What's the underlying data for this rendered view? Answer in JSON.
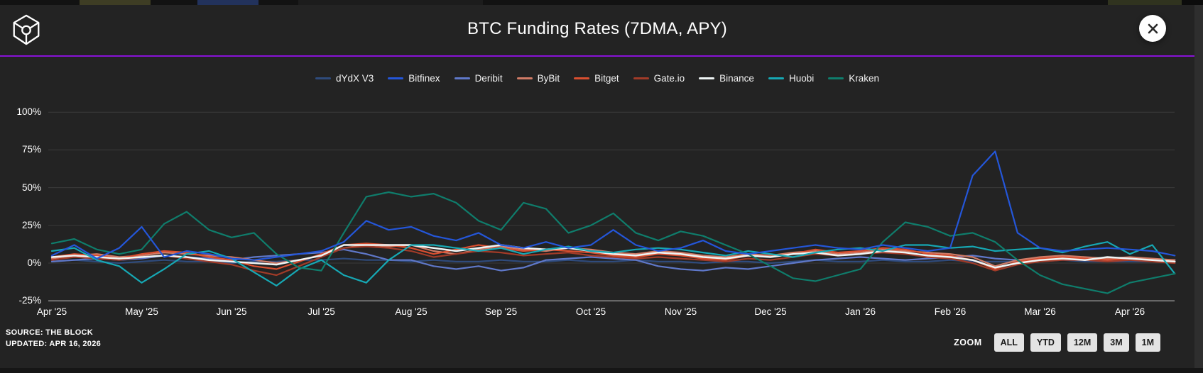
{
  "header": {
    "title": "BTC Funding Rates (7DMA, APY)"
  },
  "footer": {
    "source": "SOURCE: THE BLOCK",
    "updated": "UPDATED: APR 16, 2026"
  },
  "zoom_controls": {
    "label": "ZOOM",
    "buttons": [
      "ALL",
      "YTD",
      "12M",
      "3M",
      "1M"
    ]
  },
  "colors": {
    "background": "#232323",
    "header_divider": "#8812d6",
    "gridline": "#3b3b3b",
    "axis_line": "#8f8f8f",
    "text": "#ffffff",
    "close_button_bg": "#ffffff",
    "close_button_x": "#2a2a2a",
    "zoom_button_bg": "#e4e4e4"
  },
  "chart_data": {
    "type": "line",
    "title": "BTC Funding Rates (7DMA, APY)",
    "unit": "%",
    "ylim": [
      -25,
      100
    ],
    "grid": true,
    "legend_position": "top-center",
    "y_ticks": [
      100,
      75,
      50,
      25,
      0,
      -25
    ],
    "x_tick_labels": [
      "Apr '25",
      "May '25",
      "Jun '25",
      "Jul '25",
      "Aug '25",
      "Sep '25",
      "Oct '25",
      "Nov '25",
      "Dec '25",
      "Jan '26",
      "Feb '26",
      "Mar '26",
      "Apr '26"
    ],
    "x_start": "Apr 2025",
    "x_end": "Apr 16, 2026",
    "points_per_month": 4,
    "series": [
      {
        "name": "dYdX V3",
        "color": "#2f4b7c",
        "values": [
          1,
          2,
          1,
          0,
          1,
          2,
          1,
          1,
          0,
          1,
          1,
          2,
          2,
          3,
          2,
          2,
          1,
          2,
          1,
          1,
          2,
          1,
          1,
          2,
          1,
          1,
          2,
          1,
          1,
          0,
          1,
          1,
          0,
          1,
          2,
          1,
          1,
          2,
          1,
          1,
          2,
          1,
          1,
          1,
          1,
          2,
          1,
          1,
          1,
          1,
          1
        ]
      },
      {
        "name": "Deribit",
        "color": "#5f78c9",
        "values": [
          1,
          2,
          3,
          2,
          3,
          5,
          4,
          3,
          2,
          4,
          5,
          6,
          7,
          9,
          6,
          2,
          2,
          -2,
          -4,
          -2,
          -5,
          -3,
          2,
          3,
          4,
          3,
          2,
          -2,
          -4,
          -5,
          -3,
          -4,
          -2,
          0,
          2,
          3,
          4,
          3,
          2,
          3,
          4,
          5,
          3,
          2,
          3,
          4,
          3,
          2,
          3,
          2,
          2
        ]
      },
      {
        "name": "ByBit",
        "color": "#d07b66",
        "values": [
          3,
          5,
          6,
          4,
          5,
          7,
          6,
          5,
          4,
          2,
          0,
          2,
          5,
          10,
          12,
          11,
          12,
          8,
          6,
          9,
          11,
          9,
          8,
          10,
          9,
          7,
          6,
          8,
          7,
          5,
          4,
          6,
          5,
          7,
          8,
          6,
          7,
          9,
          8,
          7,
          6,
          4,
          -2,
          2,
          4,
          5,
          4,
          3,
          4,
          3,
          2
        ]
      },
      {
        "name": "Gate.io",
        "color": "#a13b28",
        "values": [
          2,
          4,
          3,
          2,
          4,
          5,
          3,
          1,
          -1,
          -5,
          -8,
          -2,
          4,
          10,
          11,
          10,
          8,
          4,
          6,
          8,
          7,
          5,
          6,
          7,
          5,
          4,
          3,
          4,
          3,
          2,
          1,
          3,
          2,
          4,
          6,
          5,
          6,
          7,
          6,
          4,
          3,
          0,
          -5,
          -1,
          1,
          2,
          2,
          1,
          2,
          1,
          0
        ]
      },
      {
        "name": "Bitget",
        "color": "#d94f30",
        "values": [
          4,
          6,
          5,
          3,
          6,
          8,
          7,
          4,
          2,
          -2,
          -4,
          1,
          6,
          12,
          13,
          12,
          10,
          6,
          9,
          12,
          10,
          8,
          9,
          8,
          7,
          5,
          4,
          6,
          5,
          3,
          2,
          5,
          4,
          6,
          9,
          7,
          8,
          10,
          9,
          6,
          5,
          2,
          -4,
          1,
          3,
          4,
          3,
          2,
          3,
          2,
          1
        ]
      },
      {
        "name": "Binance",
        "color": "#eef4f4",
        "values": [
          4,
          5,
          4,
          3,
          4,
          5,
          4,
          2,
          1,
          0,
          -1,
          2,
          5,
          12,
          12,
          12,
          12,
          10,
          8,
          10,
          12,
          10,
          9,
          10,
          8,
          6,
          5,
          7,
          6,
          4,
          3,
          5,
          4,
          6,
          7,
          5,
          6,
          8,
          7,
          5,
          4,
          2,
          -3,
          0,
          2,
          3,
          2,
          4,
          3,
          2,
          1
        ]
      },
      {
        "name": "Huobi",
        "color": "#16a8b4",
        "values": [
          8,
          10,
          2,
          -2,
          -13,
          -4,
          6,
          8,
          3,
          -6,
          -15,
          -4,
          2,
          -8,
          -13,
          2,
          12,
          12,
          10,
          8,
          10,
          6,
          9,
          11,
          8,
          7,
          9,
          10,
          9,
          7,
          5,
          8,
          6,
          4,
          7,
          9,
          10,
          8,
          12,
          12,
          10,
          11,
          8,
          9,
          10,
          7,
          11,
          14,
          6,
          12,
          -7
        ]
      },
      {
        "name": "Kraken",
        "color": "#0f7d6c",
        "values": [
          13,
          16,
          9,
          6,
          9,
          26,
          34,
          22,
          17,
          20,
          6,
          -3,
          -5,
          20,
          44,
          47,
          44,
          46,
          40,
          28,
          22,
          40,
          36,
          20,
          25,
          33,
          20,
          15,
          21,
          18,
          12,
          6,
          -2,
          -10,
          -12,
          -8,
          -4,
          14,
          27,
          24,
          18,
          20,
          14,
          2,
          -8,
          -14,
          -17,
          -20,
          -13,
          -10,
          -7
        ]
      },
      {
        "name": "Bitfinex",
        "color": "#2456d9",
        "values": [
          5,
          12,
          3,
          10,
          24,
          4,
          8,
          6,
          3,
          2,
          4,
          6,
          8,
          14,
          28,
          22,
          24,
          18,
          15,
          20,
          12,
          10,
          14,
          10,
          12,
          22,
          12,
          8,
          10,
          15,
          8,
          6,
          8,
          10,
          12,
          10,
          9,
          12,
          10,
          8,
          10,
          58,
          74,
          20,
          10,
          8,
          9,
          10,
          9,
          8,
          5
        ]
      }
    ],
    "legend_order": [
      "dYdX V3",
      "Bitfinex",
      "Deribit",
      "ByBit",
      "Bitget",
      "Gate.io",
      "Binance",
      "Huobi",
      "Kraken"
    ]
  }
}
